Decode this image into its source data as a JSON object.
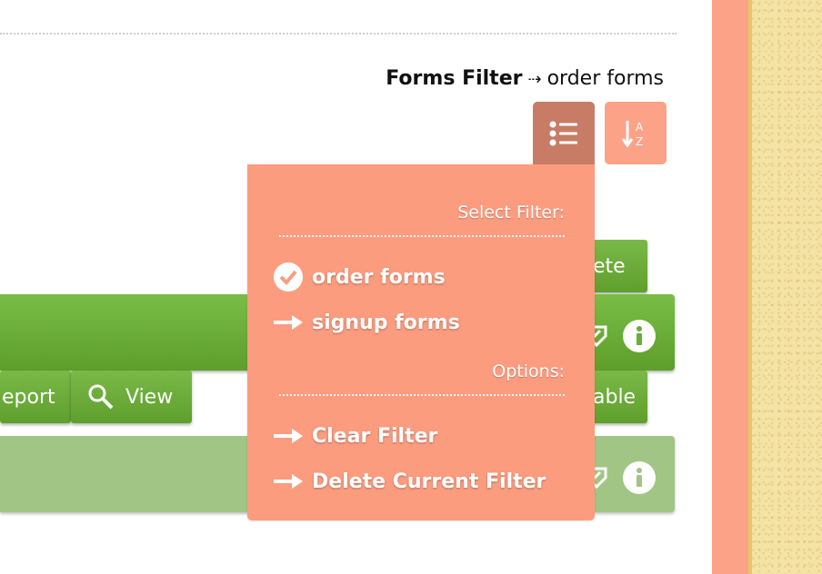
{
  "header": {
    "filter_title": "Forms Filter",
    "filter_arrow": "⇢",
    "filter_value": "order forms",
    "list_icon": "list-icon",
    "sort_icon": "sort-az-icon"
  },
  "background_rows": {
    "delete_label_fragment": "ete",
    "report_label_fragment": "eport",
    "view_label": "View",
    "disable_label_fragment": "able"
  },
  "dropdown": {
    "select_heading": "Select Filter:",
    "filters": [
      {
        "label": "order forms",
        "icon": "check-circle-icon",
        "selected": true
      },
      {
        "label": "signup forms",
        "icon": "arrow-right-icon",
        "selected": false
      }
    ],
    "options_heading": "Options:",
    "options": [
      {
        "label": "Clear Filter",
        "icon": "arrow-right-icon"
      },
      {
        "label": "Delete Current Filter",
        "icon": "arrow-right-icon"
      }
    ]
  },
  "colors": {
    "accent_salmon": "#fca287",
    "active_button": "#c97c65",
    "green": "#6aad37",
    "green_muted": "#a0c585"
  }
}
